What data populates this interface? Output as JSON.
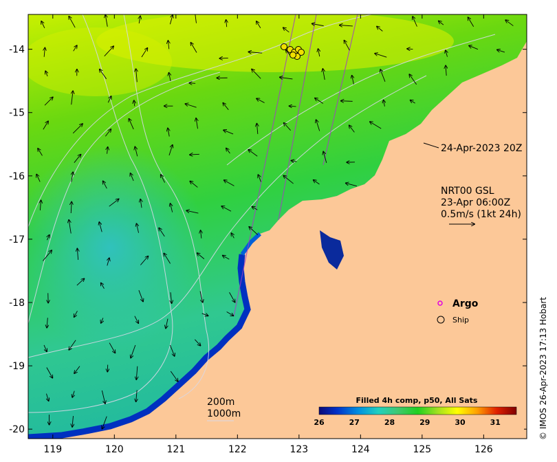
{
  "map": {
    "x_ticks": [
      "119",
      "120",
      "121",
      "122",
      "123",
      "124",
      "125",
      "126"
    ],
    "y_ticks": [
      "-14",
      "-15",
      "-16",
      "-17",
      "-18",
      "-19",
      "-20"
    ],
    "x_range": [
      118.6,
      126.7
    ],
    "y_range": [
      -20.15,
      -13.45
    ],
    "land_color": "#fcc898"
  },
  "annotations": {
    "track_time": "24-Apr-2023 20Z",
    "current_source": "NRT00 GSL",
    "current_time": "23-Apr 06:00Z",
    "current_scale": "0.5m/s (1kt 24h)",
    "contour_200": "200m",
    "contour_1000": "1000m"
  },
  "legend": {
    "argo": "Argo",
    "ship": "Ship",
    "argo_color": "#e000e0"
  },
  "colorbar": {
    "title": "Filled 4h comp, p50, All Sats",
    "ticks": [
      "26",
      "27",
      "28",
      "29",
      "30",
      "31"
    ],
    "range": [
      26,
      31.6
    ],
    "colors": [
      "#0a0a78",
      "#0030c8",
      "#0090e0",
      "#20d0c0",
      "#40c870",
      "#20d020",
      "#a0e020",
      "#ffff00",
      "#ffa000",
      "#e02000",
      "#800000"
    ]
  },
  "credit": "© IMOS 26-Apr-2023 17:13 Hobart"
}
